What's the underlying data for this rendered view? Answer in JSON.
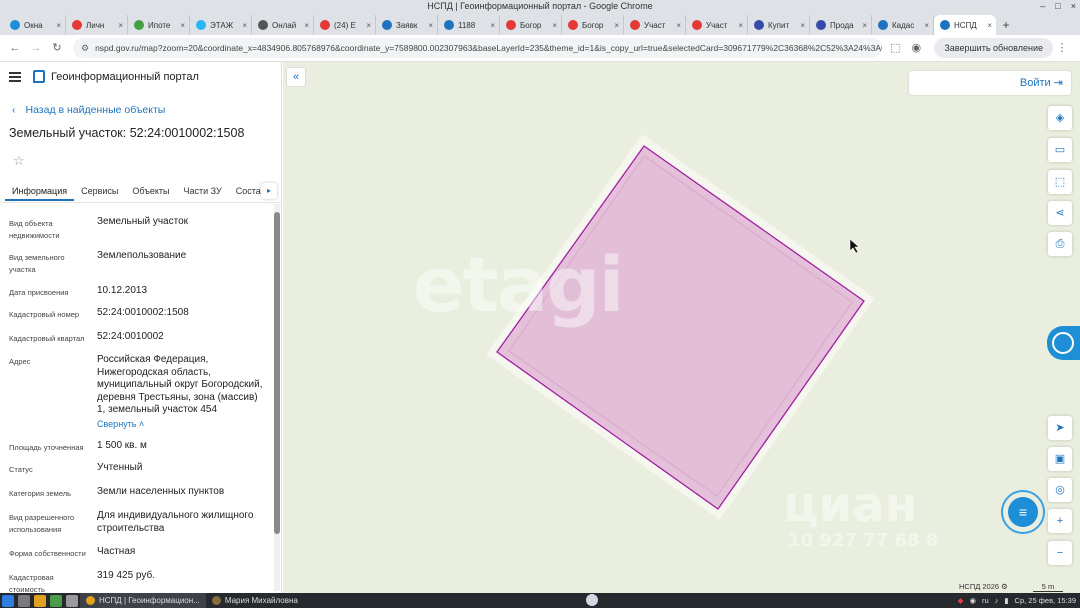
{
  "window": {
    "title": "НСПД | Геоинформационный портал - Google Chrome"
  },
  "tabs": [
    {
      "label": "Окна",
      "color": "#1e8fd6"
    },
    {
      "label": "Личн",
      "color": "#e53935"
    },
    {
      "label": "Ипоте",
      "color": "#43a047"
    },
    {
      "label": "ЭТАЖ",
      "color": "#29b6f6"
    },
    {
      "label": "Онлай",
      "color": "#555555"
    },
    {
      "label": "(24) E",
      "color": "#e53935"
    },
    {
      "label": "Заявк",
      "color": "#1e73be"
    },
    {
      "label": "1188",
      "color": "#1e73be"
    },
    {
      "label": "Богор",
      "color": "#e53935"
    },
    {
      "label": "Богор",
      "color": "#e53935"
    },
    {
      "label": "Участ",
      "color": "#e53935"
    },
    {
      "label": "Участ",
      "color": "#e53935"
    },
    {
      "label": "Купит",
      "color": "#3949ab"
    },
    {
      "label": "Прода",
      "color": "#3949ab"
    },
    {
      "label": "Кадас",
      "color": "#1e73be"
    },
    {
      "label": "НСПД",
      "color": "#1e73be",
      "active": true
    }
  ],
  "address": {
    "url": "nspd.gov.ru/map?zoom=20&coordinate_x=4834906.805768976&coordinate_y=7589800.002307963&baseLayerId=235&theme_id=1&is_copy_url=true&selectedCard=309671779%2C36368%2C52%3A24%3A0010002%3...",
    "update_button": "Завершить обновление"
  },
  "portal": {
    "name": "Геоинформационный портал"
  },
  "panel": {
    "back_link": "Назад в найденные объекты",
    "title": "Земельный участок: 52:24:0010002:1508",
    "tabs": [
      "Информация",
      "Сервисы",
      "Объекты",
      "Части ЗУ",
      "Состав"
    ],
    "properties": [
      {
        "label": "Вид объекта недвижимости",
        "value": "Земельный участок"
      },
      {
        "label": "Вид земельного участка",
        "value": "Землепользование"
      },
      {
        "label": "Дата присвоения",
        "value": "10.12.2013"
      },
      {
        "label": "Кадастровый номер",
        "value": "52:24:0010002:1508"
      },
      {
        "label": "Кадастровый квартал",
        "value": "52:24:0010002"
      },
      {
        "label": "Адрес",
        "value": "Российская Федерация, Нижегородская область, муниципальный округ Богородский, деревня Трестьяны, зона (массив) 1, земельный участок 454"
      },
      {
        "label": "Площадь уточненная",
        "value": "1 500 кв. м"
      },
      {
        "label": "Статус",
        "value": "Учтенный"
      },
      {
        "label": "Категория земель",
        "value": "Земли населенных пунктов"
      },
      {
        "label": "Вид разрешенного использования",
        "value": "Для индивидуального жилищного строительства"
      },
      {
        "label": "Форма собственности",
        "value": "Частная"
      },
      {
        "label": "Кадастровая стоимость",
        "value": "319 425 руб."
      }
    ],
    "collapse_link": "Свернуть"
  },
  "map": {
    "login": "Войти",
    "attribution": "НСПД 2026",
    "scale": "5 m",
    "watermark_1": "etagi",
    "watermark_2": "циан",
    "watermark_phone": "10 927 77 68 8",
    "parcel_color": "#a020a0",
    "parcel_fill": "#e0b6d6",
    "tools": [
      "layers-icon",
      "ruler-icon",
      "select-area-icon",
      "share-icon",
      "print-icon"
    ],
    "bottom_tools": [
      "locate-icon",
      "basemap-icon",
      "gps-icon",
      "zoom-in-icon",
      "zoom-out-icon"
    ]
  },
  "taskbar": {
    "items": [
      {
        "label": "НСПД | Геоинформацион...",
        "active": true
      },
      {
        "label": "Мария Михайловна",
        "active": false
      }
    ],
    "lang": "ru",
    "clock": "Ср, 25 фев, 15:39"
  }
}
